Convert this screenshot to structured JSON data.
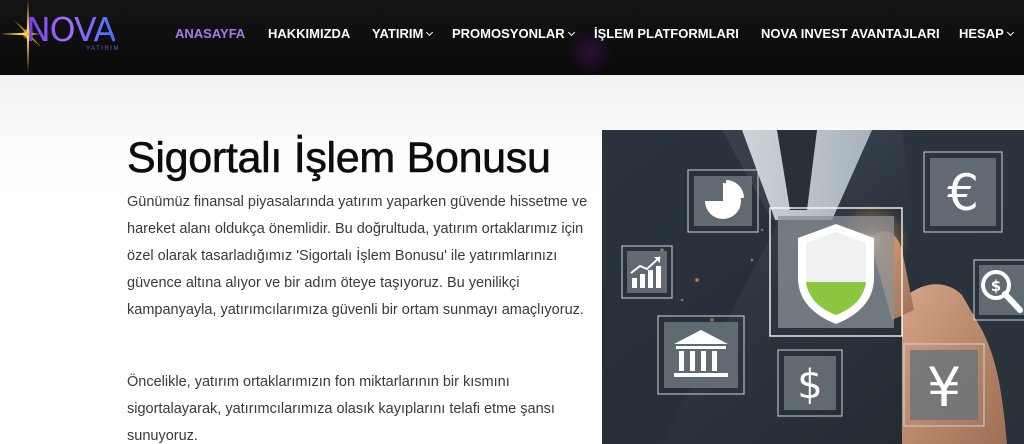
{
  "brand": {
    "logo_text": "NOVA",
    "logo_subtext": "YATIRIM",
    "colors": {
      "accent": "#a57ae8",
      "navbar": "#111111",
      "logo_purple": "#7a5cff",
      "shield_green": "#8cc63f"
    }
  },
  "nav": {
    "items": [
      {
        "label": "ANASAYFA",
        "active": true,
        "has_dropdown": false
      },
      {
        "label": "HAKKIMIZDA",
        "active": false,
        "has_dropdown": false
      },
      {
        "label": "YATIRIM",
        "active": false,
        "has_dropdown": true
      },
      {
        "label": "PROMOSYONLAR",
        "active": false,
        "has_dropdown": true
      },
      {
        "label": "İŞLEM PLATFORMLARI",
        "active": false,
        "has_dropdown": false
      },
      {
        "label": "NOVA INVEST AVANTAJLARI",
        "active": false,
        "has_dropdown": false
      },
      {
        "label": "HESAP",
        "active": false,
        "has_dropdown": true
      }
    ]
  },
  "main": {
    "title": "Sigortalı İşlem Bonusu",
    "paragraphs": [
      "Günümüz finansal piyasalarında yatırım yaparken güvende hissetme ve hareket alanı oldukça önemlidir. Bu doğrultuda, yatırım ortaklarımız için özel olarak tasarladığımız 'Sigortalı İşlem Bonusu' ile yatırımlarınızı güvence altına alıyor ve bir adım öteye taşıyoruz. Bu yenilikçi kampanyayla, yatırımcılarımıza güvenli bir ortam sunmayı amaçlıyoruz.",
      "Öncelikle, yatırım ortaklarımızın fon miktarlarının bir kısmını sigortalayarak, yatırımcılarımıza olasık kayıplarını telafi etme şansı sunuyoruz."
    ]
  },
  "hero_image": {
    "icons": [
      "pie-chart-icon",
      "euro-icon",
      "growth-chart-icon",
      "shield-icon",
      "search-dollar-icon",
      "bank-icon",
      "dollar-icon",
      "yen-icon"
    ],
    "symbols": {
      "euro": "€",
      "dollar": "$",
      "yen": "¥"
    }
  }
}
